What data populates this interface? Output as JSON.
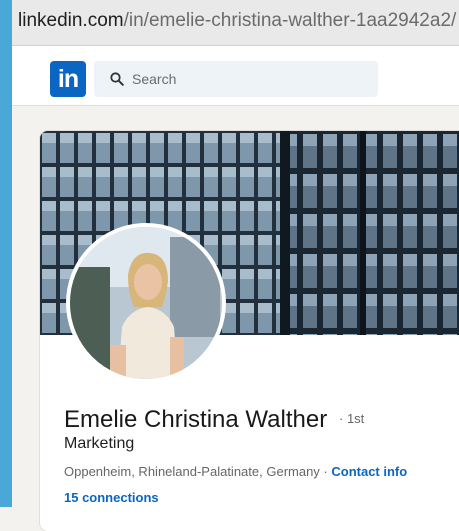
{
  "browser": {
    "url_host": "linkedin.com",
    "url_path": "/in/emelie-christina-walther-1aa2942a2/"
  },
  "nav": {
    "logo_text": "in",
    "search_placeholder": "Search",
    "search_icon": "search-icon"
  },
  "profile": {
    "name": "Emelie Christina Walther",
    "degree": "· 1st",
    "headline": "Marketing",
    "location": "Oppenheim, Rhineland-Palatinate, Germany",
    "separator": " · ",
    "contact_info_label": "Contact info",
    "connections_label": "15 connections"
  },
  "colors": {
    "brand_blue": "#0a66c2",
    "page_background": "#f3f2ef",
    "search_background": "#eef3f8"
  }
}
